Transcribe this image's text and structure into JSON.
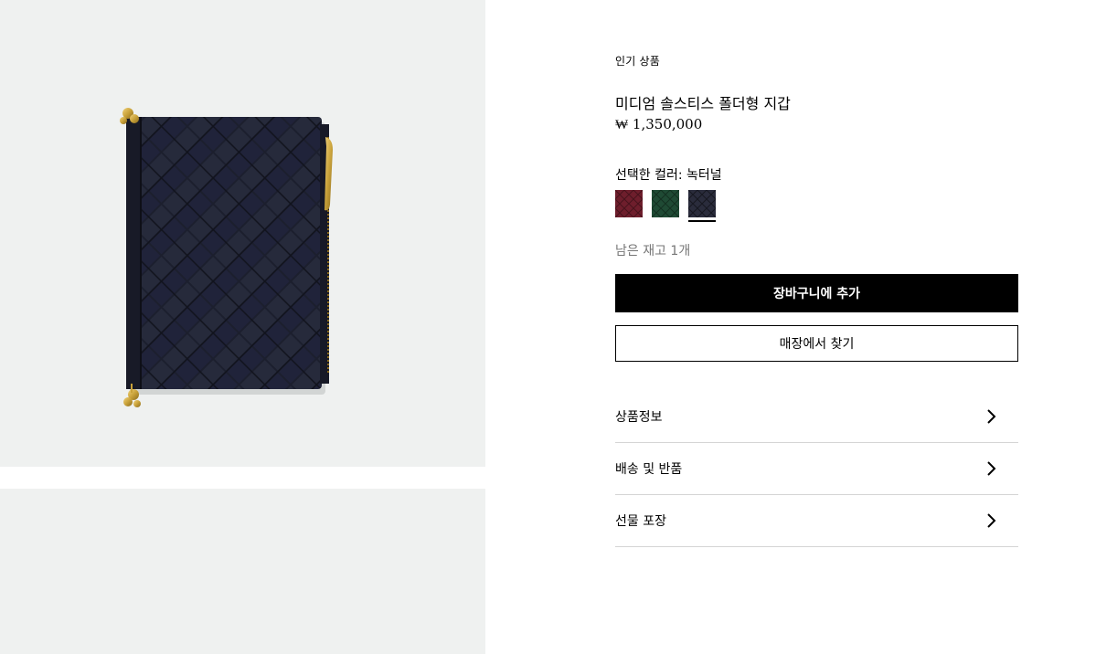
{
  "product": {
    "eyebrow": "인기 상품",
    "title": "미디엄 솔스티스 폴더형 지갑",
    "price": "₩ 1,350,000",
    "color_label": "선택한 컬러: 녹터널",
    "stock": "남은 재고 1개"
  },
  "swatches": [
    {
      "name": "burgundy",
      "color": "#6e1e2c",
      "selected": false
    },
    {
      "name": "green",
      "color": "#1f4a34",
      "selected": false
    },
    {
      "name": "nocturnal",
      "color": "#2a2c3c",
      "selected": true
    }
  ],
  "actions": {
    "add_to_cart": "장바구니에 추가",
    "find_in_store": "매장에서 찾기"
  },
  "accordion": [
    {
      "label": "상품정보",
      "icon": "chevron-right-icon"
    },
    {
      "label": "배송 및 반품",
      "icon": "chevron-right-icon"
    },
    {
      "label": "선물 포장",
      "icon": "chevron-right-icon"
    }
  ],
  "colors": {
    "image_background": "#eff1f0",
    "wallet": "#1c1f2e",
    "hardware_gold": "#c9a23a",
    "primary_button": "#000000",
    "divider": "#d5d5d5"
  }
}
